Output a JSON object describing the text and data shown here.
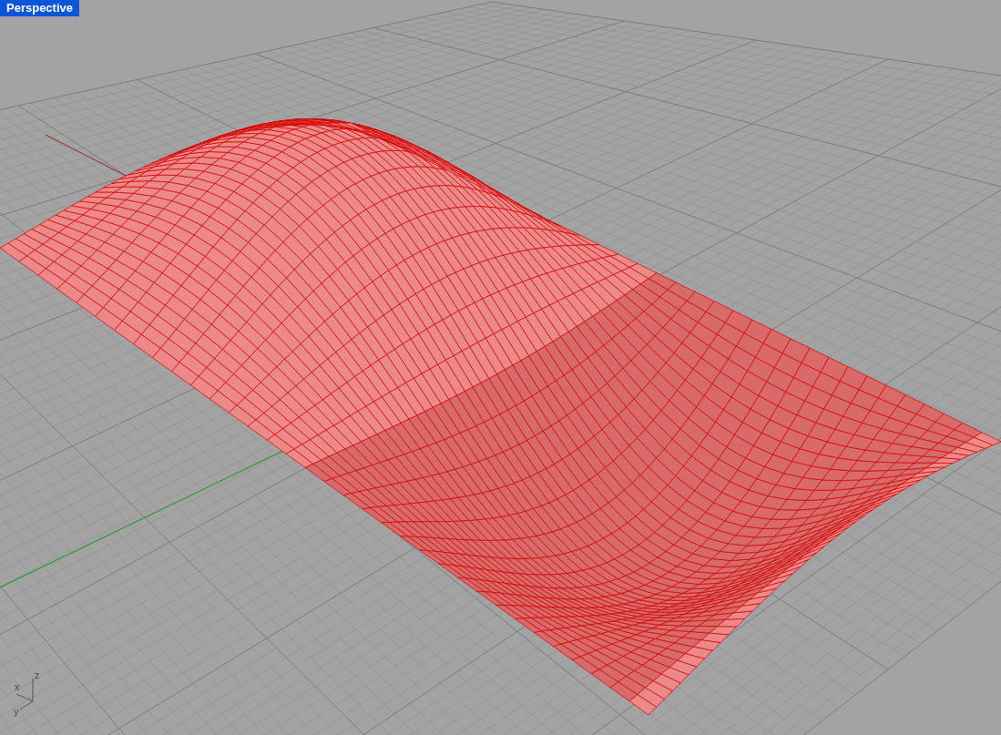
{
  "viewport": {
    "title": "Perspective",
    "selected": true
  },
  "axes_gizmo": {
    "x_label": "x",
    "y_label": "y",
    "z_label": "z"
  }
}
